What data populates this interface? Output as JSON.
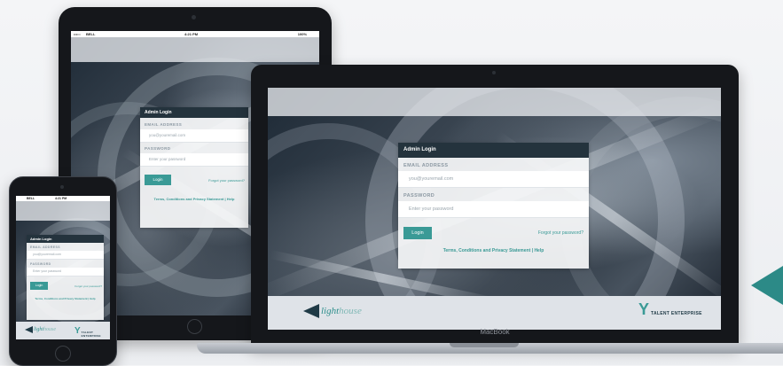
{
  "status_bar": {
    "carrier": "BELL",
    "time": "4:21 PM",
    "battery": "100%"
  },
  "login": {
    "title": "Admin Login",
    "email_label": "EMAIL ADDRESS",
    "email_placeholder": "you@youremail.com",
    "password_label": "PASSWORD",
    "password_placeholder": "Enter your password",
    "login_button": "Login",
    "forgot_link": "Forgot your password?",
    "terms_link": "Terms, Conditions and Privacy Statement",
    "separator": "|",
    "help_link": "Help"
  },
  "footer": {
    "lighthouse_a": "light",
    "lighthouse_b": "house",
    "talent_enterprise": "TALENT ENTERPRISE"
  },
  "laptop": {
    "brand": "MacBook"
  },
  "colors": {
    "accent": "#3a9a96",
    "card_header": "#24333d",
    "bezel": "#15171b"
  },
  "icons": [
    "camera-icon",
    "home-button-icon",
    "wifi-icon",
    "battery-icon",
    "lighthouse-logo-icon",
    "talent-enterprise-logo-icon",
    "arrow-left-icon"
  ]
}
